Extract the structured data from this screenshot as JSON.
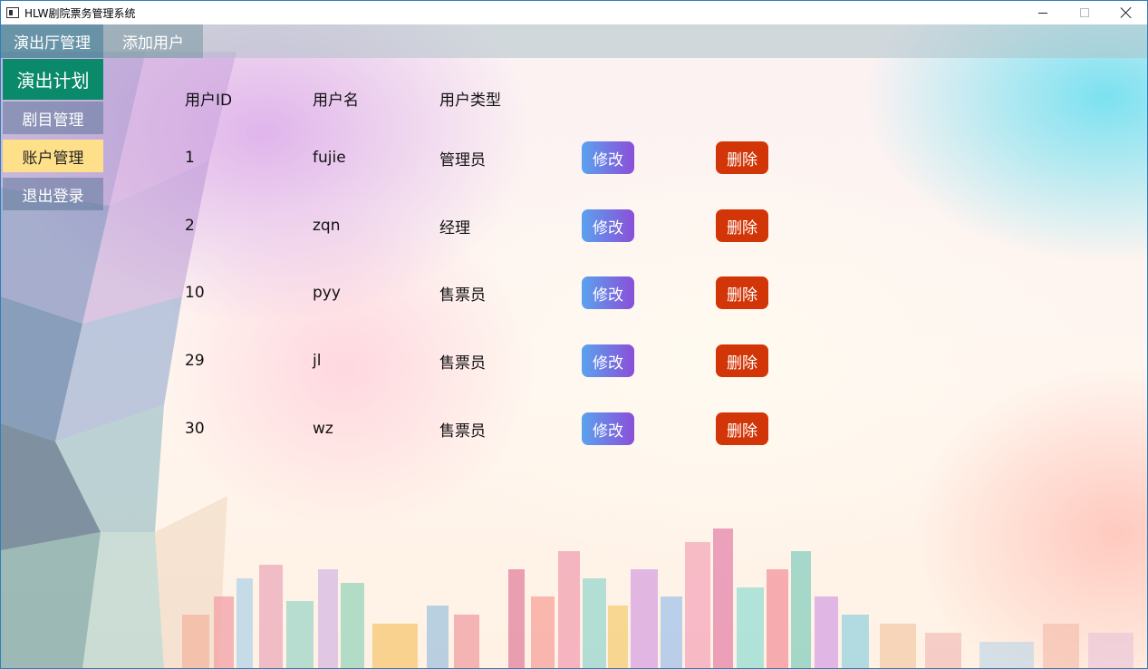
{
  "window": {
    "title": "HLW剧院票务管理系统"
  },
  "topbar": {
    "tabs": [
      {
        "label": "演出厅管理"
      },
      {
        "label": "添加用户"
      }
    ]
  },
  "sidebar": {
    "items": [
      {
        "label": "演出计划"
      },
      {
        "label": "剧目管理"
      },
      {
        "label": "账户管理",
        "selected": true
      },
      {
        "label": "退出登录"
      }
    ]
  },
  "table": {
    "headers": {
      "id": "用户ID",
      "name": "用户名",
      "type": "用户类型"
    },
    "rows": [
      {
        "id": "1",
        "name": "fujie",
        "type": "管理员",
        "edit": "修改",
        "delete": "删除"
      },
      {
        "id": "2",
        "name": "zqn",
        "type": "经理",
        "edit": "修改",
        "delete": "删除"
      },
      {
        "id": "10",
        "name": "pyy",
        "type": "售票员",
        "edit": "修改",
        "delete": "删除"
      },
      {
        "id": "29",
        "name": "jl",
        "type": "售票员",
        "edit": "修改",
        "delete": "删除"
      },
      {
        "id": "30",
        "name": "wz",
        "type": "售票员",
        "edit": "修改",
        "delete": "删除"
      }
    ]
  },
  "colors": {
    "primary_nav": "#0a8a6a",
    "selected_nav": "#ffe08a",
    "edit_gradient_start": "#5aa2ee",
    "edit_gradient_end": "#8a4fd8",
    "delete_button": "#d23608"
  },
  "icons": {
    "app": "app-icon",
    "minimize": "minimize-icon",
    "maximize": "maximize-icon",
    "close": "close-icon"
  }
}
